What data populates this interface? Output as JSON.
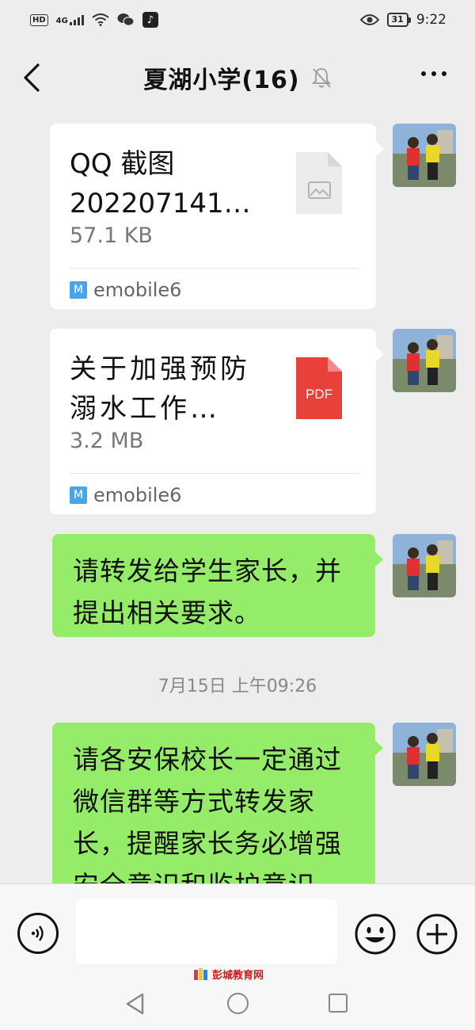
{
  "status_bar": {
    "network_badge": "HD",
    "signal_label": "4G",
    "battery": "31",
    "time": "9:22"
  },
  "header": {
    "title": "夏湖小学(16)"
  },
  "messages": [
    {
      "type": "file",
      "file_name": "QQ 截图 202207141…",
      "file_size": "57.1 KB",
      "source": "emobile6",
      "file_icon": "image-file-icon"
    },
    {
      "type": "file",
      "file_name": "关于加强预防溺水工作…",
      "file_size": "3.2 MB",
      "source": "emobile6",
      "file_icon": "pdf-file-icon",
      "file_icon_label": "PDF"
    },
    {
      "type": "text",
      "text": "请转发给学生家长，并提出相关要求。"
    },
    {
      "type": "text",
      "text": "请各安保校长一定通过微信群等方式转发家长，提醒家长务必增强安全意识和监护意识."
    }
  ],
  "timestamp": "7月15日 上午09:26",
  "input": {
    "value": "",
    "placeholder": ""
  },
  "watermark": "彭城教育网",
  "colors": {
    "background": "#ededed",
    "sent_bubble": "#95ec69",
    "file_card": "#ffffff",
    "pdf_red": "#e8413c"
  }
}
